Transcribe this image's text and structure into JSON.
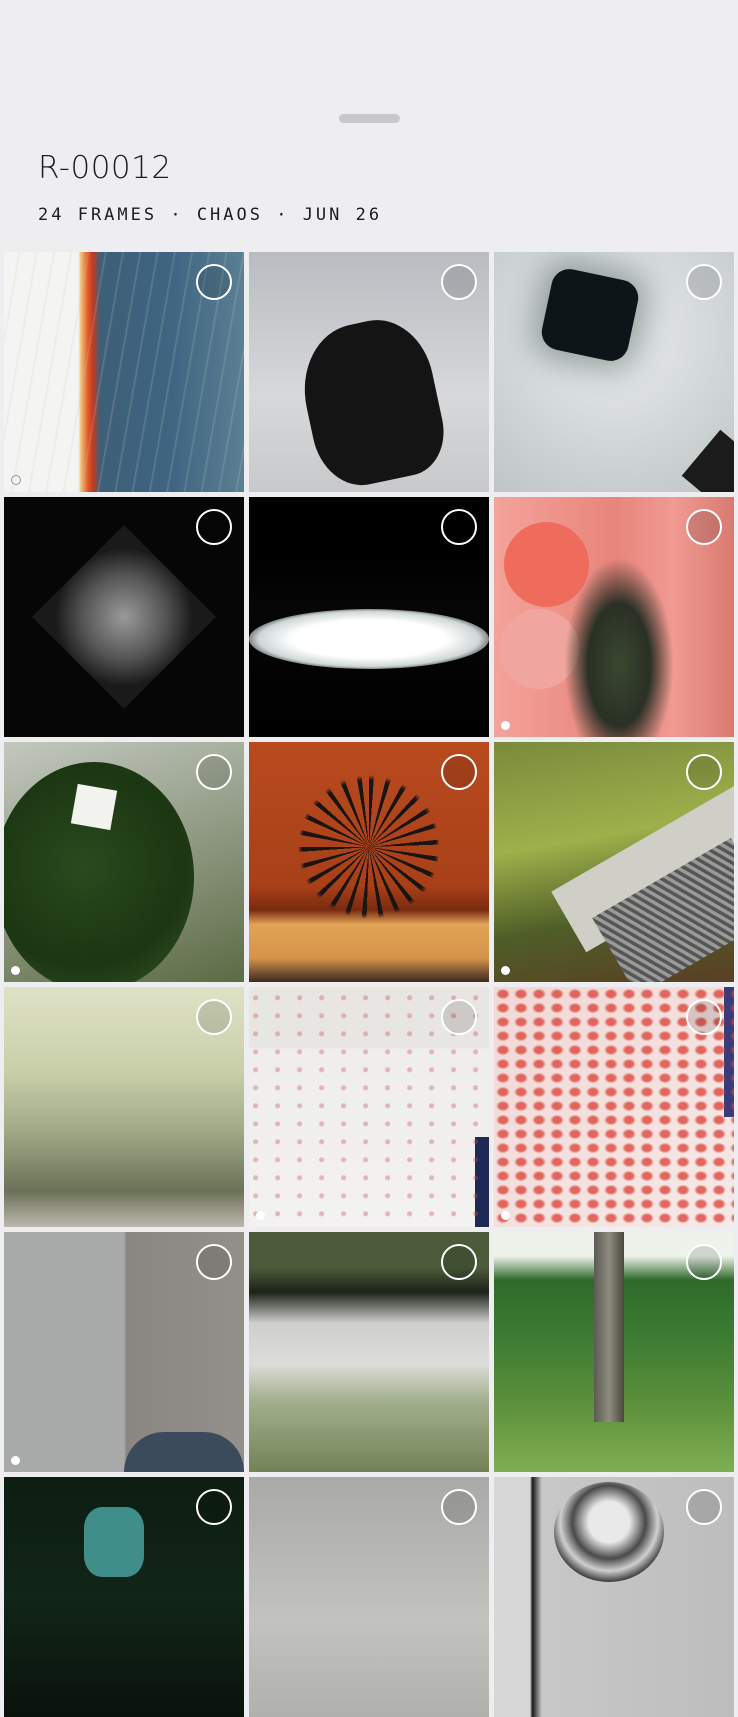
{
  "sheet": {
    "roll_title": "R-00012",
    "roll_meta": "24 FRAMES · CHAOS · JUN 26"
  },
  "frames": [
    {
      "id": 1,
      "selected": false,
      "indicator": "outline"
    },
    {
      "id": 2,
      "selected": false,
      "indicator": "none"
    },
    {
      "id": 3,
      "selected": false,
      "indicator": "none"
    },
    {
      "id": 4,
      "selected": false,
      "indicator": "none"
    },
    {
      "id": 5,
      "selected": false,
      "indicator": "none"
    },
    {
      "id": 6,
      "selected": false,
      "indicator": "filled"
    },
    {
      "id": 7,
      "selected": false,
      "indicator": "filled"
    },
    {
      "id": 8,
      "selected": false,
      "indicator": "none"
    },
    {
      "id": 9,
      "selected": false,
      "indicator": "filled"
    },
    {
      "id": 10,
      "selected": false,
      "indicator": "none"
    },
    {
      "id": 11,
      "selected": false,
      "indicator": "filled"
    },
    {
      "id": 12,
      "selected": false,
      "indicator": "filled"
    },
    {
      "id": 13,
      "selected": false,
      "indicator": "filled"
    },
    {
      "id": 14,
      "selected": false,
      "indicator": "none"
    },
    {
      "id": 15,
      "selected": false,
      "indicator": "none"
    },
    {
      "id": 16,
      "selected": false,
      "indicator": "none"
    },
    {
      "id": 17,
      "selected": false,
      "indicator": "none"
    },
    {
      "id": 18,
      "selected": false,
      "indicator": "none"
    }
  ]
}
